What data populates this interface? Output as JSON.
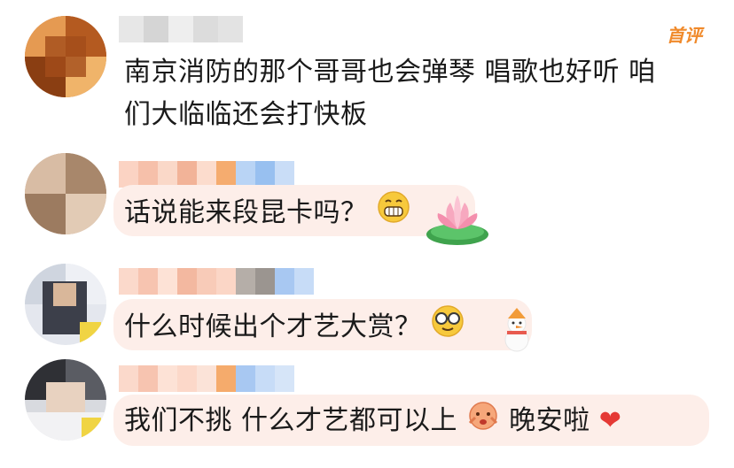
{
  "comments": [
    {
      "text_line1": "南京消防的那个哥哥也会弹琴 唱歌也好听   咱",
      "text_line2": "们大临临还会打快板",
      "badge": "首评"
    },
    {
      "text": "话说能来段昆卡吗？"
    },
    {
      "text": "什么时候出个才艺大赏？"
    },
    {
      "text_a": "我们不挑  什么才艺都可以上",
      "text_b": "晚安啦"
    }
  ],
  "colors": {
    "bubble": "#fdeee9",
    "badge": "#f08a2b",
    "heart": "#e53935"
  }
}
